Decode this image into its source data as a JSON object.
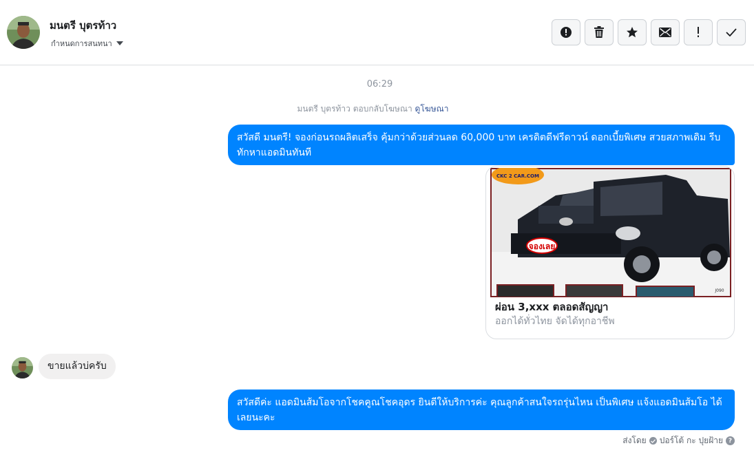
{
  "header": {
    "contact_name": "มนตรี บุตรท้าว",
    "convo_menu_label": "กำหนดการสนทนา"
  },
  "toolbar": {
    "buttons": [
      {
        "name": "spam-button",
        "icon": "alert-circle-icon"
      },
      {
        "name": "delete-button",
        "icon": "trash-icon"
      },
      {
        "name": "star-button",
        "icon": "star-icon"
      },
      {
        "name": "mark-unread-button",
        "icon": "envelope-icon"
      },
      {
        "name": "flag-button",
        "icon": "exclamation-icon"
      },
      {
        "name": "mark-done-button",
        "icon": "check-icon"
      }
    ]
  },
  "thread": {
    "timestamp": "06:29",
    "ad_reply_text": "มนตรี บุตรท้าว ตอบกลับโฆษณา",
    "ad_reply_link": "ดูโฆษณา",
    "messages": [
      {
        "from": "page",
        "text": "สวัสดี มนตรี! จองก่อนรถผลิตเสร็จ คุ้มกว่าด้วยส่วนลด 60,000 บาท เครดิตดีฟรีดาวน์ ดอกเบี้ยพิเศษ สวยสภาพเดิม รีบทักหาแอดมินทันที"
      },
      {
        "from": "user",
        "text": "ขายแล้วบ่ครับ"
      },
      {
        "from": "page",
        "text": "สวัสดีค่ะ แอดมินส้มโอจากโชคคูณโชคอุดร ยินดีให้บริการค่ะ   คุณลูกค้าสนใจรถรุ่นไหน เป็นพิเศษ แจ้งแอดมินส้มโอ ได้เลยนะคะ"
      }
    ],
    "ad_card": {
      "title": "ผ่อน 3,xxx ตลอดสัญญา",
      "subtitle": "ออกได้ทั่วไทย จัดได้ทุกอาชีพ",
      "logo_text": "CKC 2 CAR.COM",
      "badge_text": "จองเลย",
      "plate_text": "J090"
    },
    "sent_by_label": "ส่งโดย",
    "sent_by_name": "ปอร์โต้ กะ ปุยฝ้าย"
  },
  "colors": {
    "outgoing_bubble": "#0084ff",
    "incoming_bubble": "#f1f0f0",
    "link": "#385898"
  }
}
